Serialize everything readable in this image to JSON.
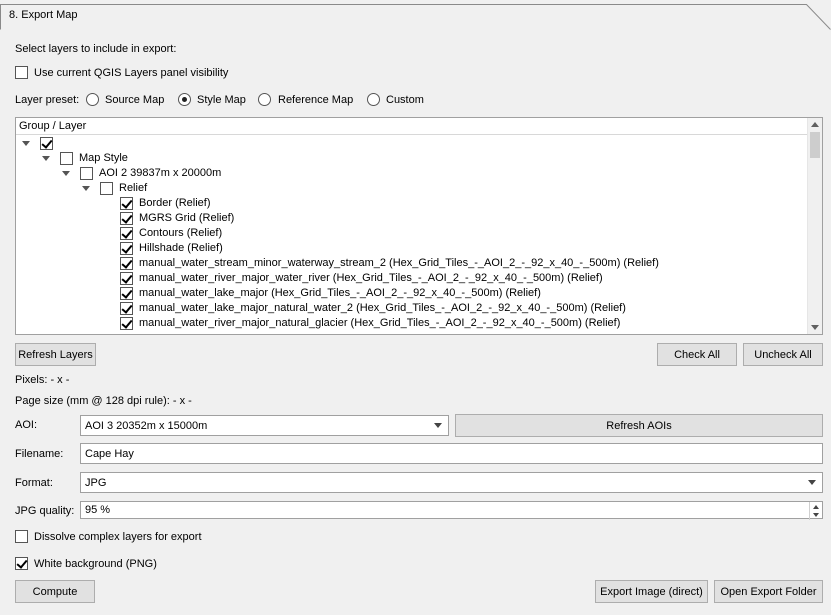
{
  "section": {
    "title": "8. Export Map"
  },
  "select_layers_label": "Select layers to include in export:",
  "use_visibility": {
    "label": "Use current QGIS Layers panel visibility",
    "checked": false
  },
  "preset": {
    "label": "Layer preset:",
    "options": [
      "Source Map",
      "Style Map",
      "Reference Map",
      "Custom"
    ],
    "selected": "Style Map"
  },
  "tree": {
    "header": "Group / Layer",
    "rows": [
      {
        "label": "",
        "checked": true,
        "expanded": true,
        "level": 0
      },
      {
        "label": "Map Style",
        "checked": false,
        "expanded": true,
        "level": 1
      },
      {
        "label": "AOI 2 39837m x 20000m",
        "checked": false,
        "expanded": true,
        "level": 2
      },
      {
        "label": "Relief",
        "checked": false,
        "expanded": true,
        "level": 3
      },
      {
        "label": "Border (Relief)",
        "checked": true,
        "level": 4
      },
      {
        "label": "MGRS Grid (Relief)",
        "checked": true,
        "level": 4
      },
      {
        "label": "Contours (Relief)",
        "checked": true,
        "level": 4
      },
      {
        "label": "Hillshade (Relief)",
        "checked": true,
        "level": 4
      },
      {
        "label": "manual_water_stream_minor_waterway_stream_2 (Hex_Grid_Tiles_-_AOI_2_-_92_x_40_-_500m) (Relief)",
        "checked": true,
        "level": 4
      },
      {
        "label": "manual_water_river_major_water_river (Hex_Grid_Tiles_-_AOI_2_-_92_x_40_-_500m) (Relief)",
        "checked": true,
        "level": 4
      },
      {
        "label": "manual_water_lake_major (Hex_Grid_Tiles_-_AOI_2_-_92_x_40_-_500m) (Relief)",
        "checked": true,
        "level": 4
      },
      {
        "label": "manual_water_lake_major_natural_water_2 (Hex_Grid_Tiles_-_AOI_2_-_92_x_40_-_500m) (Relief)",
        "checked": true,
        "level": 4
      },
      {
        "label": "manual_water_river_major_natural_glacier (Hex_Grid_Tiles_-_AOI_2_-_92_x_40_-_500m) (Relief)",
        "checked": true,
        "level": 4
      }
    ]
  },
  "buttons": {
    "refresh_layers": "Refresh Layers",
    "check_all": "Check All",
    "uncheck_all": "Uncheck All",
    "refresh_aois": "Refresh AOIs",
    "compute": "Compute",
    "export_image": "Export Image (direct)",
    "open_folder": "Open Export Folder"
  },
  "pixels": "Pixels: - x -",
  "page_size": "Page size (mm @ 128 dpi rule): - x -",
  "aoi": {
    "label": "AOI:",
    "value": "AOI 3 20352m x 15000m"
  },
  "filename": {
    "label": "Filename:",
    "value": "Cape Hay"
  },
  "format": {
    "label": "Format:",
    "value": "JPG"
  },
  "jpg_quality": {
    "label": "JPG quality:",
    "value": "95 %"
  },
  "dissolve": {
    "label": "Dissolve complex layers for export",
    "checked": false
  },
  "white_bg": {
    "label": "White background (PNG)",
    "checked": true
  }
}
